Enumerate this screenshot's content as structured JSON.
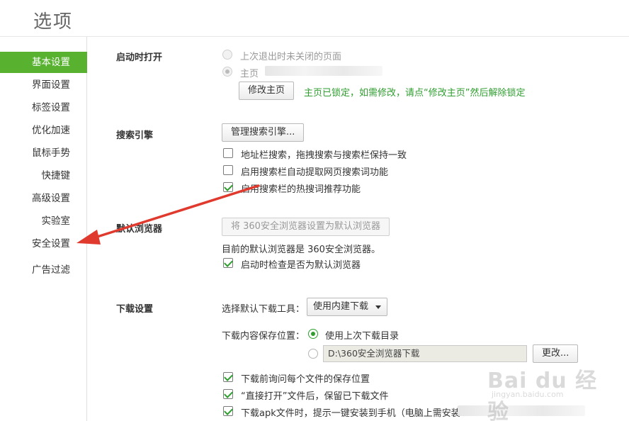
{
  "window": {
    "title": "选项"
  },
  "sidebar": {
    "items": [
      {
        "label": "基本设置",
        "active": true
      },
      {
        "label": "界面设置"
      },
      {
        "label": "标签设置"
      },
      {
        "label": "优化加速"
      },
      {
        "label": "鼠标手势"
      },
      {
        "label": "快捷键"
      },
      {
        "label": "高级设置"
      },
      {
        "label": "实验室"
      },
      {
        "label": "安全设置"
      },
      {
        "label": "广告过滤"
      }
    ]
  },
  "startup": {
    "section_label": "启动时打开",
    "option_last_session": "上次退出时未关闭的页面",
    "option_homepage": "主页",
    "modify_homepage_button": "修改主页",
    "lock_notice": "主页已锁定，如需修改，请点“修改主页”然后解除锁定"
  },
  "search": {
    "section_label": "搜索引擎",
    "manage_button": "管理搜索引擎...",
    "checkbox_address_bar": "地址栏搜索，拖拽搜索与搜索栏保持一致",
    "checkbox_address_bar_checked": false,
    "checkbox_auto_extract": "启用搜索栏自动提取网页搜索词功能",
    "checkbox_auto_extract_checked": false,
    "checkbox_hot_words": "启用搜索栏的热搜词推荐功能",
    "checkbox_hot_words_checked": true
  },
  "default_browser": {
    "section_label": "默认浏览器",
    "set_default_button": "将 360安全浏览器设置为默认浏览器",
    "current_status": "目前的默认浏览器是 360安全浏览器。",
    "check_on_startup": "启动时检查是否为默认浏览器",
    "check_on_startup_checked": true
  },
  "download": {
    "section_label": "下载设置",
    "tool_label": "选择默认下载工具：",
    "tool_selected": "使用内建下载",
    "location_label": "下载内容保存位置：",
    "option_last_dir": "使用上次下载目录",
    "path_value": "D:\\360安全浏览器下载",
    "change_button": "更改...",
    "checkbox_ask_location": "下载前询问每个文件的保存位置",
    "checkbox_keep_after_open": "“直接打开”文件后，保留已下载文件",
    "checkbox_apk_prompt": "下载apk文件时，提示一键安装到手机（电脑上需安装"
  },
  "watermark": {
    "main": "Bai du 经验",
    "sub": "jingyan.baidu.com"
  },
  "colors": {
    "accent": "#58b22f",
    "notice": "#2f9e2f",
    "annotation_arrow": "#e03a2e"
  }
}
